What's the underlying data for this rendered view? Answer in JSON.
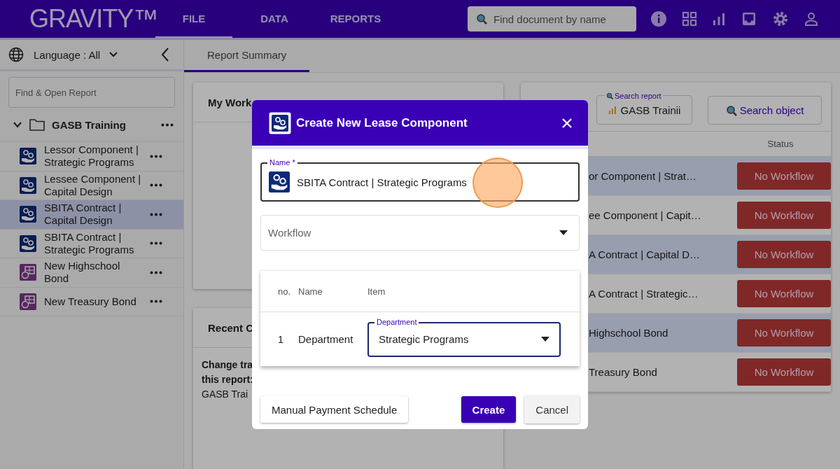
{
  "header": {
    "logo": "GRAVITY™",
    "nav": [
      {
        "label": "FILE",
        "selected": true
      },
      {
        "label": "DATA",
        "selected": false
      },
      {
        "label": "REPORTS",
        "selected": false
      }
    ],
    "search": {
      "placeholder": "Find document by name"
    }
  },
  "sidebar": {
    "language": "Language : All",
    "search": {
      "placeholder": "Find & Open Report"
    },
    "folder": {
      "name": "GASB Training",
      "expanded": true,
      "children": [
        {
          "name": "Lessor Component | Strategic Programs",
          "kind": "lease",
          "selected": false
        },
        {
          "name": "Lessee Component | Capital Design",
          "kind": "lease",
          "selected": false
        },
        {
          "name": "SBITA Contract | Capital Design",
          "kind": "lease",
          "selected": true
        },
        {
          "name": "SBITA Contract | Strategic Programs",
          "kind": "lease",
          "selected": false
        },
        {
          "name": "New Highschool Bond",
          "kind": "bond",
          "selected": false
        },
        {
          "name": "New Treasury Bond",
          "kind": "bond",
          "selected": false
        }
      ]
    }
  },
  "tabs": [
    {
      "label": "Report Summary",
      "selected": true
    }
  ],
  "workflow_card": {
    "title": "My Work"
  },
  "recent_card": {
    "title": "Recent C",
    "heading_lines": [
      "Change tra",
      "this report:"
    ],
    "value": "GASB Trai"
  },
  "report_panel": {
    "search_report": {
      "label": "Search report",
      "value": "GASB Trainii"
    },
    "search_object": "Search object",
    "status_column": "Status",
    "rows": [
      {
        "name": "or Component | Strat…",
        "status": "No Workflow",
        "highlighted": true
      },
      {
        "name": "ee Component | Capit…",
        "status": "No Workflow",
        "highlighted": false
      },
      {
        "name": "A Contract | Capital D…",
        "status": "No Workflow",
        "highlighted": true
      },
      {
        "name": "A Contract | Strategic…",
        "status": "No Workflow",
        "highlighted": false
      },
      {
        "name": "Highschool Bond",
        "status": "No Workflow",
        "highlighted": true
      },
      {
        "name": "Treasury Bond",
        "status": "No Workflow",
        "highlighted": false
      }
    ]
  },
  "dialog": {
    "title": "Create New Lease Component",
    "name_field": {
      "label": "Name *",
      "value": "SBITA Contract | Strategic Programs"
    },
    "workflow": {
      "placeholder": "Workflow"
    },
    "columns": [
      "no.",
      "Name",
      "Item"
    ],
    "rows": [
      {
        "no": "1",
        "name": "Department",
        "field_label": "Department",
        "value": "Strategic Programs"
      }
    ],
    "buttons": [
      {
        "label": "Manual Payment Schedule",
        "kind": "outline"
      },
      {
        "label": "Create",
        "kind": "primary"
      },
      {
        "label": "Cancel",
        "kind": "secondary"
      }
    ]
  }
}
